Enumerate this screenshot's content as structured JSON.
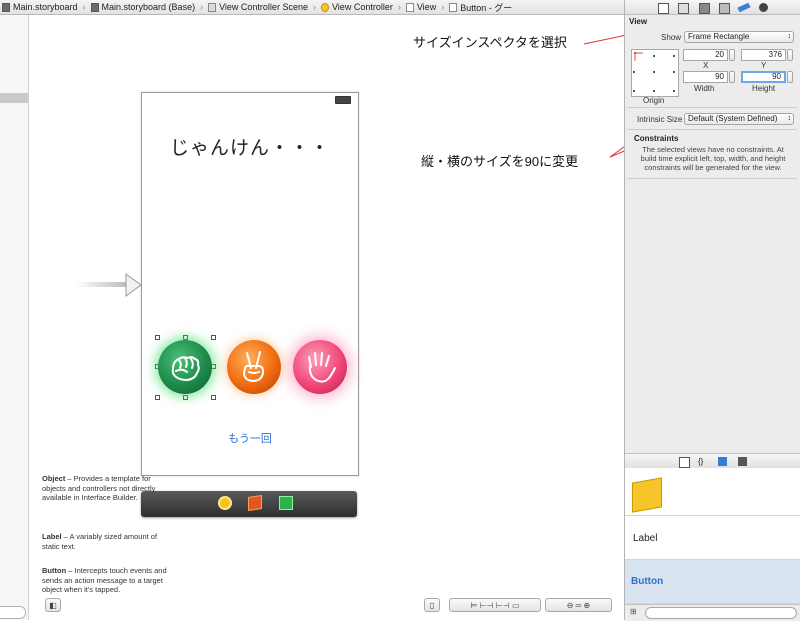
{
  "jumpbar": {
    "items": [
      "Main.storyboard",
      "Main.storyboard (Base)",
      "View Controller Scene",
      "View Controller",
      "View",
      "Button - グー"
    ]
  },
  "scene": {
    "title_label": "じゃんけん・・・",
    "retry_label": "もう一回",
    "buttons": [
      "rock",
      "scissors",
      "paper"
    ]
  },
  "annotations": {
    "size_inspector": "サイズインスペクタを選択",
    "resize": "縦・横のサイズを90に変更"
  },
  "inspector": {
    "section_title": "View",
    "show_label": "Show",
    "show_value": "Frame Rectangle",
    "x_value": "20",
    "y_value": "376",
    "x_label": "X",
    "y_label": "Y",
    "width_value": "90",
    "height_value": "90",
    "width_label": "Width",
    "height_label": "Height",
    "origin_label": "Origin",
    "intrinsic_label": "Intrinsic Size",
    "intrinsic_value": "Default (System Defined)",
    "constraints_title": "Constraints",
    "constraints_text": "The selected views have no constraints. At build time explicit left, top, width, and height constraints will be generated for the view."
  },
  "library": {
    "items": [
      {
        "title": "Object",
        "desc": " – Provides a template for objects and controllers not directly available in Interface Builder.",
        "icon_text": ""
      },
      {
        "title": "Label",
        "desc": " – A variably sized amount of static text.",
        "icon_text": "Label"
      },
      {
        "title": "Button",
        "desc": " – Intercepts touch events and sends an action message to a target object when it's tapped.",
        "icon_text": "Button"
      }
    ]
  },
  "colors": {
    "accent": "#2f6fd0",
    "annotation_line": "#e0303a",
    "rock": "#1e8a49",
    "scissors": "#f06a10",
    "paper": "#f0477a"
  }
}
